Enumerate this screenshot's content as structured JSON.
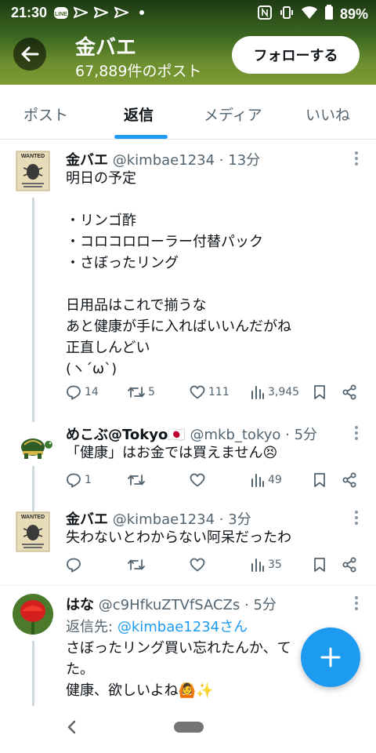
{
  "status_bar": {
    "time": "21:30",
    "battery": "89%",
    "icons": [
      "line-icon",
      "send-icon",
      "send-icon",
      "send-icon",
      "dot-icon",
      "nfc-icon",
      "vibrate-icon",
      "wifi-icon",
      "battery-icon"
    ]
  },
  "header": {
    "title": "金バエ",
    "post_count": "67,889件のポスト",
    "follow_label": "フォローする"
  },
  "tabs": [
    {
      "label": "ポスト",
      "active": false
    },
    {
      "label": "返信",
      "active": true
    },
    {
      "label": "メディア",
      "active": false
    },
    {
      "label": "いいね",
      "active": false
    }
  ],
  "tweets": [
    {
      "name": "金バエ",
      "handle": "@kimbae1234",
      "time": "13分",
      "text": "明日の予定\n\n・リンゴ酢\n・コロコロローラー付替パック\n・さぼったリング\n\n日用品はこれで揃うな\nあと健康が手に入ればいいんだがね\n正直しんどい\n(ヽ´ω`)",
      "replies": "14",
      "reposts": "5",
      "likes": "111",
      "views": "3,945"
    },
    {
      "name": "めこぶ@Tokyo",
      "flag": "🇯🇵",
      "handle": "@mkb_tokyo",
      "time": "5分",
      "text": "「健康」はお金では買えません😣",
      "replies": "1",
      "reposts": "",
      "likes": "",
      "views": "49"
    },
    {
      "name": "金バエ",
      "handle": "@kimbae1234",
      "time": "3分",
      "text": "失わないとわからない阿呆だったわ",
      "replies": "",
      "reposts": "",
      "likes": "",
      "views": "35"
    },
    {
      "name": "はな",
      "handle": "@c9HfkuZTVfSACZs",
      "time": "5分",
      "reply_to_prefix": "返信先:",
      "reply_to_user": "@kimbae1234さん",
      "text": "さぼったリング買い忘れたんか、て\nた。\n健康、欲しいよね🙆✨"
    }
  ],
  "colors": {
    "accent": "#1d9bf0",
    "muted": "#536471",
    "text": "#0f1419"
  }
}
